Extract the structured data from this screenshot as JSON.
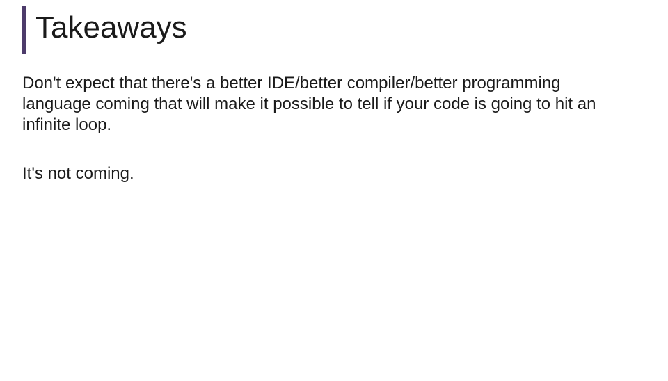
{
  "slide": {
    "title": "Takeaways",
    "paragraphs": [
      "Don't expect that there's a better IDE/better compiler/better programming language coming that will make it possible to tell if your code is going to hit an infinite loop.",
      "It's not coming."
    ]
  }
}
